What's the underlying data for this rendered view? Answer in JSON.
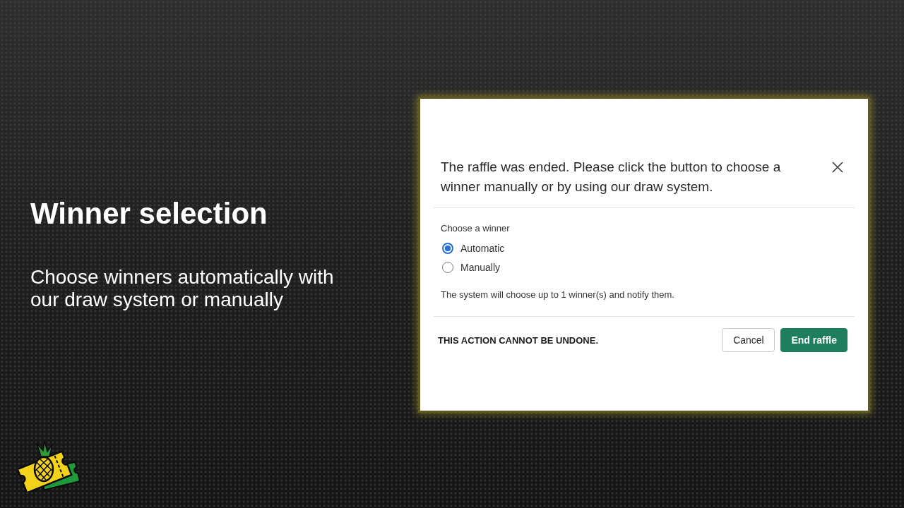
{
  "slide": {
    "title": "Winner selection",
    "subtitle": "Choose winners automatically with our draw system or manually"
  },
  "dialog": {
    "message": "The raffle was ended. Please click the button to choose a winner manually or by using our draw system.",
    "group_label": "Choose a winner",
    "options": [
      {
        "label": "Automatic",
        "selected": true
      },
      {
        "label": "Manually",
        "selected": false
      }
    ],
    "note": "The system will choose up to 1 winner(s) and notify them.",
    "warning": "THIS ACTION CANNOT BE UNDONE.",
    "buttons": [
      {
        "label": "Cancel",
        "kind": "secondary"
      },
      {
        "label": "End raffle",
        "kind": "primary"
      }
    ]
  }
}
